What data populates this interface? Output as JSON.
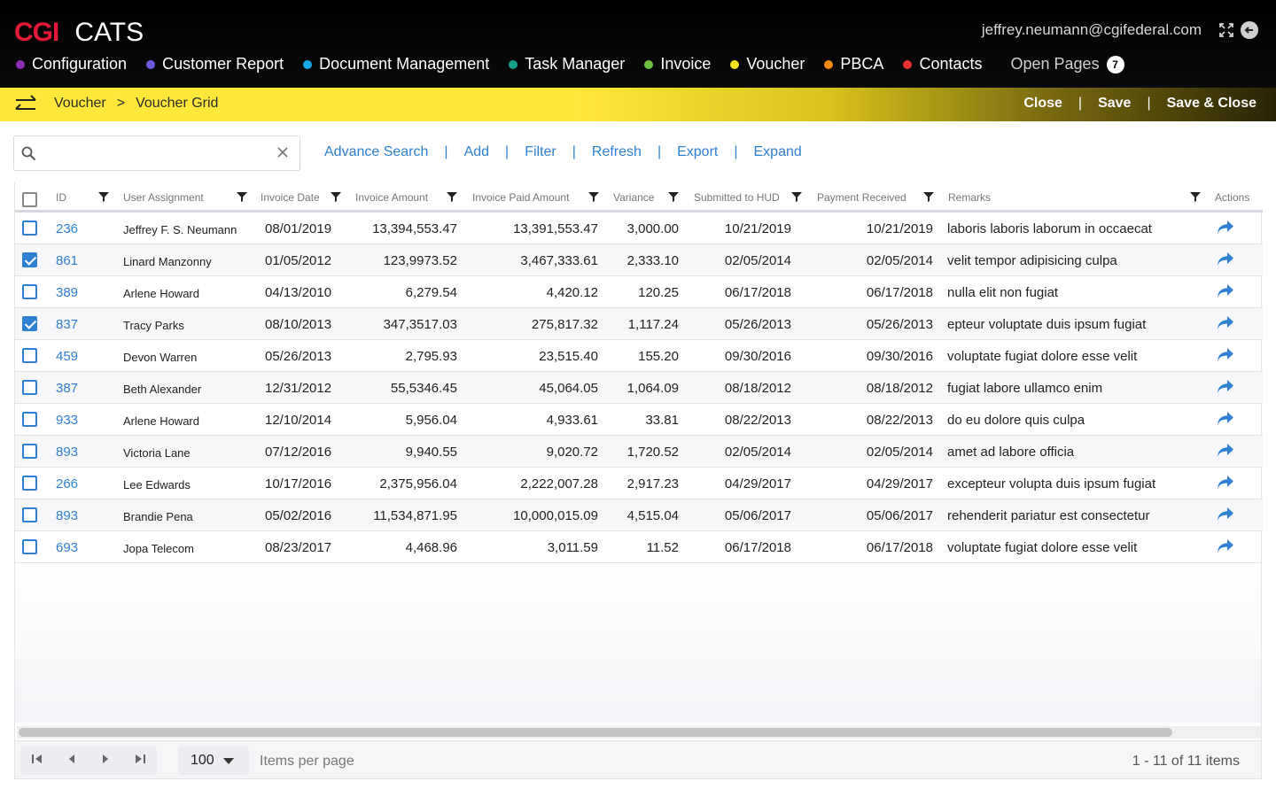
{
  "app": {
    "brand": "CGI",
    "name": "CATS",
    "user_email": "jeffrey.neumann@cgifederal.com"
  },
  "colors": {
    "brand_red": "#e31937",
    "accent_blue": "#2f80d1",
    "subbar_yellow": "#ffe83a"
  },
  "nav": [
    {
      "label": "Configuration",
      "color": "#8e2bb8"
    },
    {
      "label": "Customer Report",
      "color": "#6a5be0"
    },
    {
      "label": "Document Management",
      "color": "#19a7e6"
    },
    {
      "label": "Task Manager",
      "color": "#15a08a"
    },
    {
      "label": "Invoice",
      "color": "#6fbf3c"
    },
    {
      "label": "Voucher",
      "color": "#f2e21f"
    },
    {
      "label": "PBCA",
      "color": "#f08a12"
    },
    {
      "label": "Contacts",
      "color": "#e5322d"
    }
  ],
  "open_pages": {
    "label": "Open Pages",
    "count": "7"
  },
  "breadcrumb": {
    "parent": "Voucher",
    "sep": ">",
    "current": "Voucher Grid"
  },
  "subbar_actions": {
    "close": "Close",
    "save": "Save",
    "save_close": "Save & Close",
    "sep": "|"
  },
  "search": {
    "placeholder": ""
  },
  "toolbar": {
    "advance_search": "Advance Search",
    "add": "Add",
    "filter": "Filter",
    "refresh": "Refresh",
    "export": "Export",
    "expand": "Expand",
    "sep": "|"
  },
  "columns": {
    "id": "ID",
    "user": "User Assignment",
    "invoice_date": "Invoice Date",
    "invoice_amount": "Invoice Amount",
    "paid_amount": "Invoice Paid Amount",
    "variance": "Variance",
    "submitted": "Submitted to HUD",
    "payment_received": "Payment Received",
    "remarks": "Remarks",
    "actions": "Actions"
  },
  "rows": [
    {
      "checked": false,
      "id": "236",
      "user": "Jeffrey F. S. Neumann",
      "invoice_date": "08/01/2019",
      "invoice_amount": "13,394,553.47",
      "paid_amount": "13,391,553.47",
      "variance": "3,000.00",
      "submitted": "10/21/2019",
      "payment_received": "10/21/2019",
      "remarks": "laboris laboris laborum in occaecat"
    },
    {
      "checked": true,
      "id": "861",
      "user": "Linard Manzonny",
      "invoice_date": "01/05/2012",
      "invoice_amount": "123,9973.52",
      "paid_amount": "3,467,333.61",
      "variance": "2,333.10",
      "submitted": "02/05/2014",
      "payment_received": "02/05/2014",
      "remarks": "velit tempor adipisicing culpa"
    },
    {
      "checked": false,
      "id": "389",
      "user": "Arlene Howard",
      "invoice_date": "04/13/2010",
      "invoice_amount": "6,279.54",
      "paid_amount": "4,420.12",
      "variance": "120.25",
      "submitted": "06/17/2018",
      "payment_received": "06/17/2018",
      "remarks": "nulla elit non fugiat"
    },
    {
      "checked": true,
      "id": "837",
      "user": "Tracy Parks",
      "invoice_date": "08/10/2013",
      "invoice_amount": "347,3517.03",
      "paid_amount": "275,817.32",
      "variance": "1,117.24",
      "submitted": "05/26/2013",
      "payment_received": "05/26/2013",
      "remarks": "epteur voluptate duis ipsum fugiat"
    },
    {
      "checked": false,
      "id": "459",
      "user": "Devon Warren",
      "invoice_date": "05/26/2013",
      "invoice_amount": "2,795.93",
      "paid_amount": "23,515.40",
      "variance": "155.20",
      "submitted": "09/30/2016",
      "payment_received": "09/30/2016",
      "remarks": "voluptate fugiat dolore esse velit"
    },
    {
      "checked": false,
      "id": "387",
      "user": "Beth Alexander",
      "invoice_date": "12/31/2012",
      "invoice_amount": "55,5346.45",
      "paid_amount": "45,064.05",
      "variance": "1,064.09",
      "submitted": "08/18/2012",
      "payment_received": "08/18/2012",
      "remarks": "fugiat labore ullamco enim"
    },
    {
      "checked": false,
      "id": "933",
      "user": "Arlene Howard",
      "invoice_date": "12/10/2014",
      "invoice_amount": "5,956.04",
      "paid_amount": "4,933.61",
      "variance": "33.81",
      "submitted": "08/22/2013",
      "payment_received": "08/22/2013",
      "remarks": "do eu dolore quis culpa"
    },
    {
      "checked": false,
      "id": "893",
      "user": "Victoria Lane",
      "invoice_date": "07/12/2016",
      "invoice_amount": "9,940.55",
      "paid_amount": "9,020.72",
      "variance": "1,720.52",
      "submitted": "02/05/2014",
      "payment_received": "02/05/2014",
      "remarks": "amet ad labore officia"
    },
    {
      "checked": false,
      "id": "266",
      "user": "Lee Edwards",
      "invoice_date": "10/17/2016",
      "invoice_amount": "2,375,956.04",
      "paid_amount": "2,222,007.28",
      "variance": "2,917.23",
      "submitted": "04/29/2017",
      "payment_received": "04/29/2017",
      "remarks": "excepteur volupta duis ipsum fugiat"
    },
    {
      "checked": false,
      "id": "893",
      "user": "Brandie Pena",
      "invoice_date": "05/02/2016",
      "invoice_amount": "11,534,871.95",
      "paid_amount": "10,000,015.09",
      "variance": "4,515.04",
      "submitted": "05/06/2017",
      "payment_received": "05/06/2017",
      "remarks": "rehenderit pariatur est consectetur"
    },
    {
      "checked": false,
      "id": "693",
      "user": "Jopa Telecom",
      "invoice_date": "08/23/2017",
      "invoice_amount": "4,468.96",
      "paid_amount": "3,011.59",
      "variance": "11.52",
      "submitted": "06/17/2018",
      "payment_received": "06/17/2018",
      "remarks": "voluptate fugiat dolore esse velit"
    }
  ],
  "pager": {
    "page_size": "100",
    "items_label": "Items per page",
    "info": "1 - 11 of 11 items"
  }
}
